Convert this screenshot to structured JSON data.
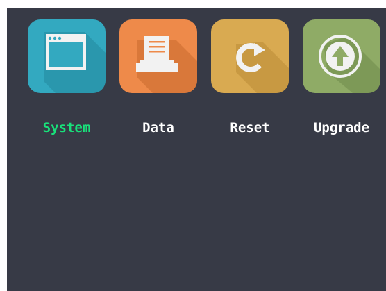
{
  "menu": {
    "items": [
      {
        "label": "System",
        "icon": "system-window-icon",
        "color": "#33a9c0",
        "selected": true
      },
      {
        "label": "Data",
        "icon": "data-tray-icon",
        "color": "#ee8a4a",
        "selected": false
      },
      {
        "label": "Reset",
        "icon": "reset-arrow-icon",
        "color": "#d9aa51",
        "selected": false
      },
      {
        "label": "Upgrade",
        "icon": "upgrade-arrow-icon",
        "color": "#8fab66",
        "selected": false
      }
    ],
    "selected_label_color": "#19e07a",
    "label_color": "#ffffff",
    "background_color": "#373a46"
  }
}
